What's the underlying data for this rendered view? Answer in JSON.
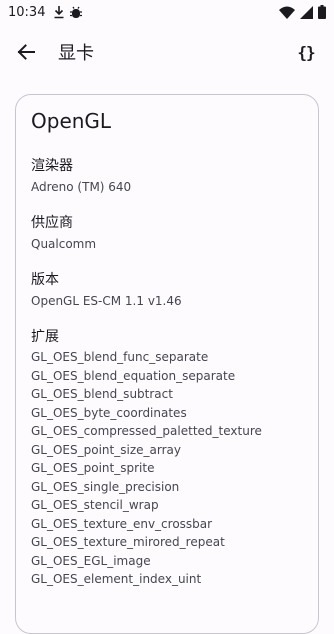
{
  "status_bar": {
    "time": "10:34",
    "left_icons": [
      "download-icon",
      "usb-debug-icon"
    ],
    "right_icons": [
      "wifi-icon",
      "signal-icon",
      "battery-icon"
    ]
  },
  "app_bar": {
    "title": "显卡",
    "back_icon": "arrow-back-icon",
    "action_icon": "json-braces-icon",
    "action_glyph": "{}"
  },
  "card": {
    "title": "OpenGL",
    "renderer": {
      "label": "渲染器",
      "value": "Adreno (TM) 640"
    },
    "vendor": {
      "label": "供应商",
      "value": "Qualcomm"
    },
    "version": {
      "label": "版本",
      "value": "OpenGL ES-CM 1.1 v1.46"
    },
    "extensions": {
      "label": "扩展",
      "items": [
        "GL_OES_blend_func_separate",
        "GL_OES_blend_equation_separate",
        "GL_OES_blend_subtract",
        "GL_OES_byte_coordinates",
        "GL_OES_compressed_paletted_texture",
        "GL_OES_point_size_array",
        "GL_OES_point_sprite",
        "GL_OES_single_precision",
        "GL_OES_stencil_wrap",
        "GL_OES_texture_env_crossbar",
        "GL_OES_texture_mirored_repeat",
        "GL_OES_EGL_image",
        "GL_OES_element_index_uint"
      ]
    }
  }
}
